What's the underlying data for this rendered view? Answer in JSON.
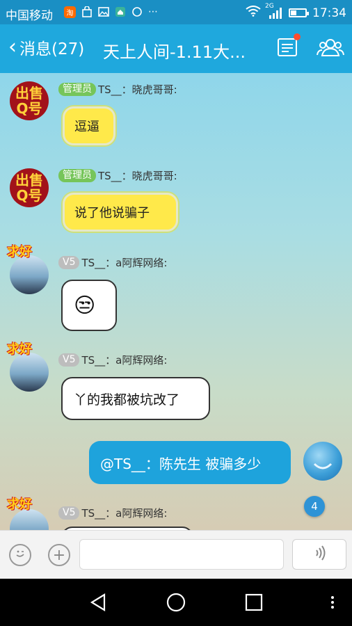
{
  "status": {
    "carrier": "中国移动",
    "taobao_badge": "淘",
    "network": "2G",
    "time": "17:34",
    "battery_level": 0.35
  },
  "header": {
    "back_label": "消息(27)",
    "title": "天上人间-1.11大..."
  },
  "messages": [
    {
      "role": "管理员",
      "sender": "TS__：晓虎哥哥:",
      "text": "逗逼",
      "style": "yellow"
    },
    {
      "role": "管理员",
      "sender": "TS__：晓虎哥哥:",
      "text": "说了他说骗子",
      "style": "yellow"
    },
    {
      "role": "V5",
      "sender": "TS__：a阿辉网络:",
      "text": "😒",
      "style": "white"
    },
    {
      "role": "V5",
      "sender": "TS__：a阿辉网络:",
      "text": "丫的我都被坑改了",
      "style": "white"
    },
    {
      "role": "",
      "sender": "",
      "text": "@TS__：陈先生 被骗多少",
      "style": "self"
    },
    {
      "role": "V5",
      "sender": "TS__：a阿辉网络:",
      "text": "",
      "style": "white"
    }
  ],
  "avatar_tags": {
    "sell_avatar": "出售Q号",
    "person_avatar_sticker": "求好"
  },
  "unread_count": "4",
  "colors": {
    "accent": "#1fa8dd",
    "admin_badge": "#76c55a",
    "v5_badge": "#bdbdbd",
    "notify_dot": "#ff4d2f"
  },
  "icons": {
    "menu": "list-icon",
    "group": "group-members-icon",
    "emoji": "smiley-icon",
    "plus": "plus-icon",
    "voice": "voice-icon"
  }
}
